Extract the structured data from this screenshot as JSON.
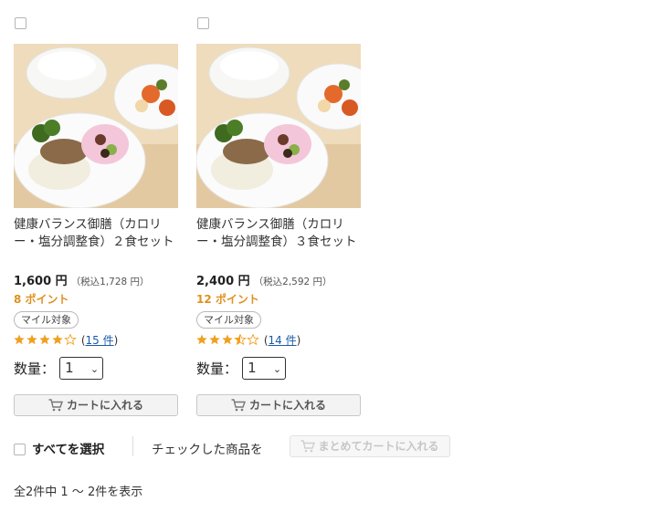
{
  "products": [
    {
      "name": "健康バランス御膳（カロリー・塩分調整食）２食セット",
      "price": "1,600 円",
      "price_tax": "（税込1,728 円）",
      "points": "8 ポイント",
      "badge": "マイル対象",
      "rating": 4.0,
      "review_count": "15 件",
      "qty_label": "数量：",
      "qty_value": "1",
      "cart_label": "カートに入れる"
    },
    {
      "name": "健康バランス御膳（カロリー・塩分調整食）３食セット",
      "price": "2,400 円",
      "price_tax": "（税込2,592 円）",
      "points": "12 ポイント",
      "badge": "マイル対象",
      "rating": 3.5,
      "review_count": "14 件",
      "qty_label": "数量：",
      "qty_value": "1",
      "cart_label": "カートに入れる"
    }
  ],
  "bulk": {
    "select_all": "すべてを選択",
    "checked_label": "チェックした商品を",
    "bulk_cart": "まとめてカートに入れる"
  },
  "result_count": "全2件中 1 〜 2件を表示",
  "colors": {
    "points": "#e0901e",
    "star": "#f0a020",
    "link": "#1a5aa8"
  },
  "icons": {
    "cart": "cart-icon",
    "star": "star-icon",
    "checkbox": "checkbox-icon"
  }
}
